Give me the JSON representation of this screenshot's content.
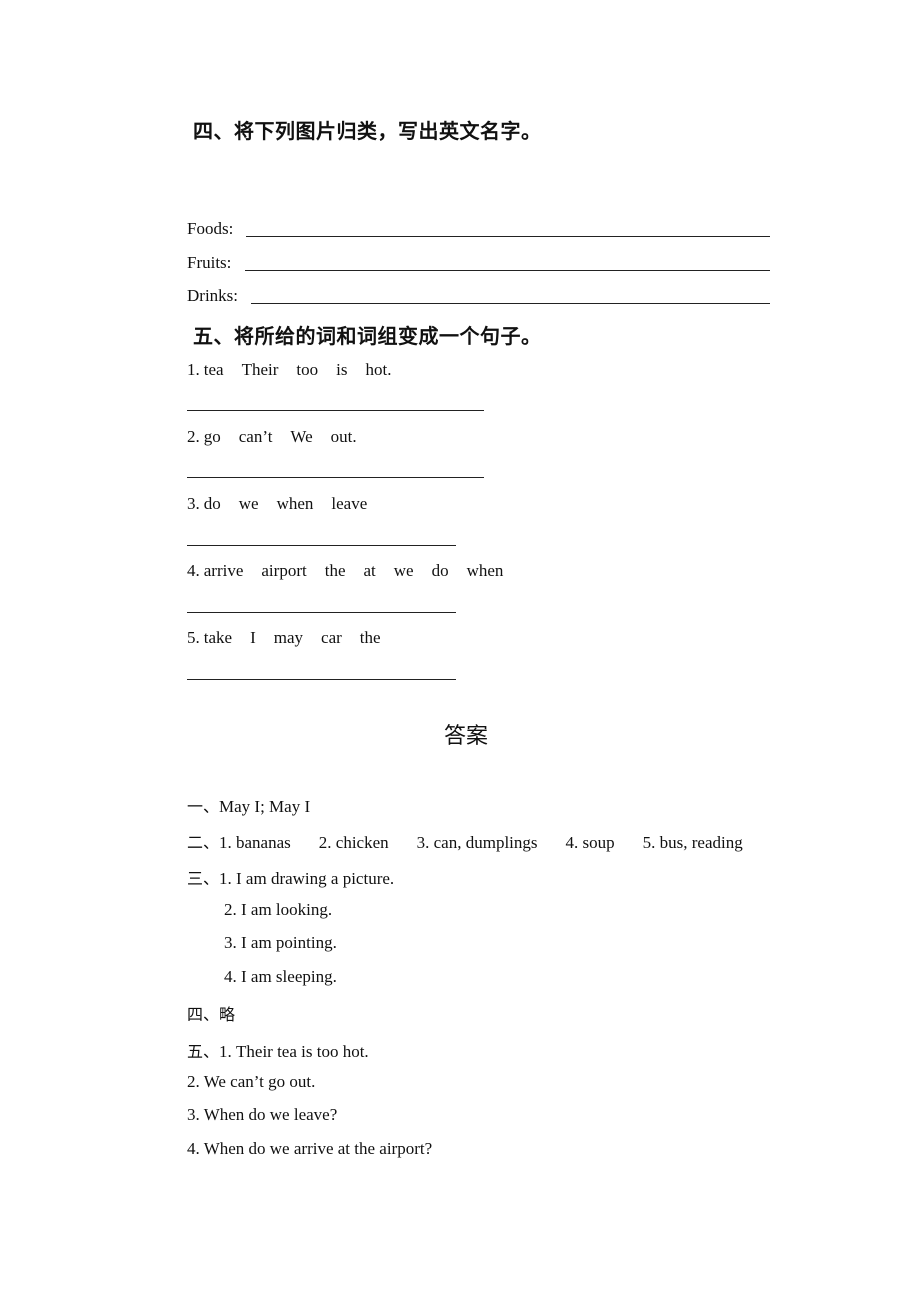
{
  "section4": {
    "heading": "四、将下列图片归类，写出英文名字。",
    "rows": [
      {
        "label": "Foods:"
      },
      {
        "label": "Fruits:"
      },
      {
        "label": "Drinks:"
      }
    ]
  },
  "section5": {
    "heading": "五、将所给的词和词组变成一个句子。",
    "items": [
      {
        "num": "1.",
        "words": [
          "tea",
          "Their",
          "too",
          "is",
          "hot."
        ]
      },
      {
        "num": "2.",
        "words": [
          "go",
          "can’t",
          "We",
          "out."
        ]
      },
      {
        "num": "3.",
        "words": [
          "do",
          "we",
          "when",
          "leave"
        ]
      },
      {
        "num": "4.",
        "words": [
          "arrive",
          "airport",
          "the",
          "at",
          "we",
          "do",
          "when"
        ]
      },
      {
        "num": "5.",
        "words": [
          "take",
          "I",
          "may",
          "car",
          "the"
        ]
      }
    ]
  },
  "answers": {
    "title": "答案",
    "a1": {
      "prefix": "一、",
      "text": "May I; May I"
    },
    "a2": {
      "prefix": "二、",
      "items": [
        "1. bananas",
        "2. chicken",
        "3. can, dumplings",
        "4. soup",
        "5. bus, reading"
      ]
    },
    "a3": {
      "prefix": "三、",
      "items": [
        "1. I am drawing a picture.",
        "2. I am looking.",
        "3. I am pointing.",
        "4. I am sleeping."
      ]
    },
    "a4": {
      "prefix": "四、",
      "text": "略"
    },
    "a5": {
      "prefix": "五、",
      "items": [
        "1. Their tea is too hot.",
        "2. We can’t go out.",
        "3. When do we leave?",
        "4. When do we arrive at the airport?"
      ]
    }
  }
}
